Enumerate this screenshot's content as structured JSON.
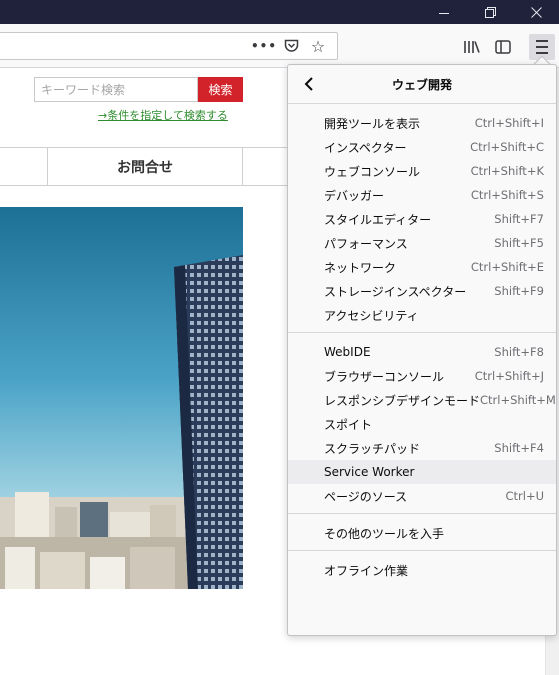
{
  "search": {
    "placeholder": "キーワード検索",
    "button_label": "検索",
    "advanced_link": "→条件を指定して検索する"
  },
  "nav": {
    "contact_label": "お問合せ"
  },
  "panel": {
    "title": "ウェブ開発",
    "group1": [
      {
        "label": "開発ツールを表示",
        "shortcut": "Ctrl+Shift+I"
      },
      {
        "label": "インスペクター",
        "shortcut": "Ctrl+Shift+C"
      },
      {
        "label": "ウェブコンソール",
        "shortcut": "Ctrl+Shift+K"
      },
      {
        "label": "デバッガー",
        "shortcut": "Ctrl+Shift+S"
      },
      {
        "label": "スタイルエディター",
        "shortcut": "Shift+F7"
      },
      {
        "label": "パフォーマンス",
        "shortcut": "Shift+F5"
      },
      {
        "label": "ネットワーク",
        "shortcut": "Ctrl+Shift+E"
      },
      {
        "label": "ストレージインスペクター",
        "shortcut": "Shift+F9"
      },
      {
        "label": "アクセシビリティ",
        "shortcut": ""
      }
    ],
    "group2": [
      {
        "label": "WebIDE",
        "shortcut": "Shift+F8"
      },
      {
        "label": "ブラウザーコンソール",
        "shortcut": "Ctrl+Shift+J"
      },
      {
        "label": "レスポンシブデザインモード",
        "shortcut": "Ctrl+Shift+M"
      },
      {
        "label": "スポイト",
        "shortcut": ""
      },
      {
        "label": "スクラッチパッド",
        "shortcut": "Shift+F4"
      },
      {
        "label": "Service Worker",
        "shortcut": ""
      },
      {
        "label": "ページのソース",
        "shortcut": "Ctrl+U"
      }
    ],
    "group3": [
      {
        "label": "その他のツールを入手",
        "shortcut": ""
      }
    ],
    "group4": [
      {
        "label": "オフライン作業",
        "shortcut": ""
      }
    ]
  },
  "icons": {
    "minimize": "minimize-icon",
    "maximize": "restore-icon",
    "close": "close-icon",
    "page_actions": "more-horizontal-icon",
    "pocket": "pocket-icon",
    "bookmark": "star-icon",
    "library": "library-icon",
    "sidebar": "sidebar-icon",
    "menu": "hamburger-menu-icon",
    "back": "back-arrow-icon"
  },
  "colors": {
    "titlebar": "#20213a",
    "search_button": "#d2232a",
    "link": "#2e8b2e",
    "panel_bg": "#f9f9fa",
    "hover": "#ececee"
  }
}
